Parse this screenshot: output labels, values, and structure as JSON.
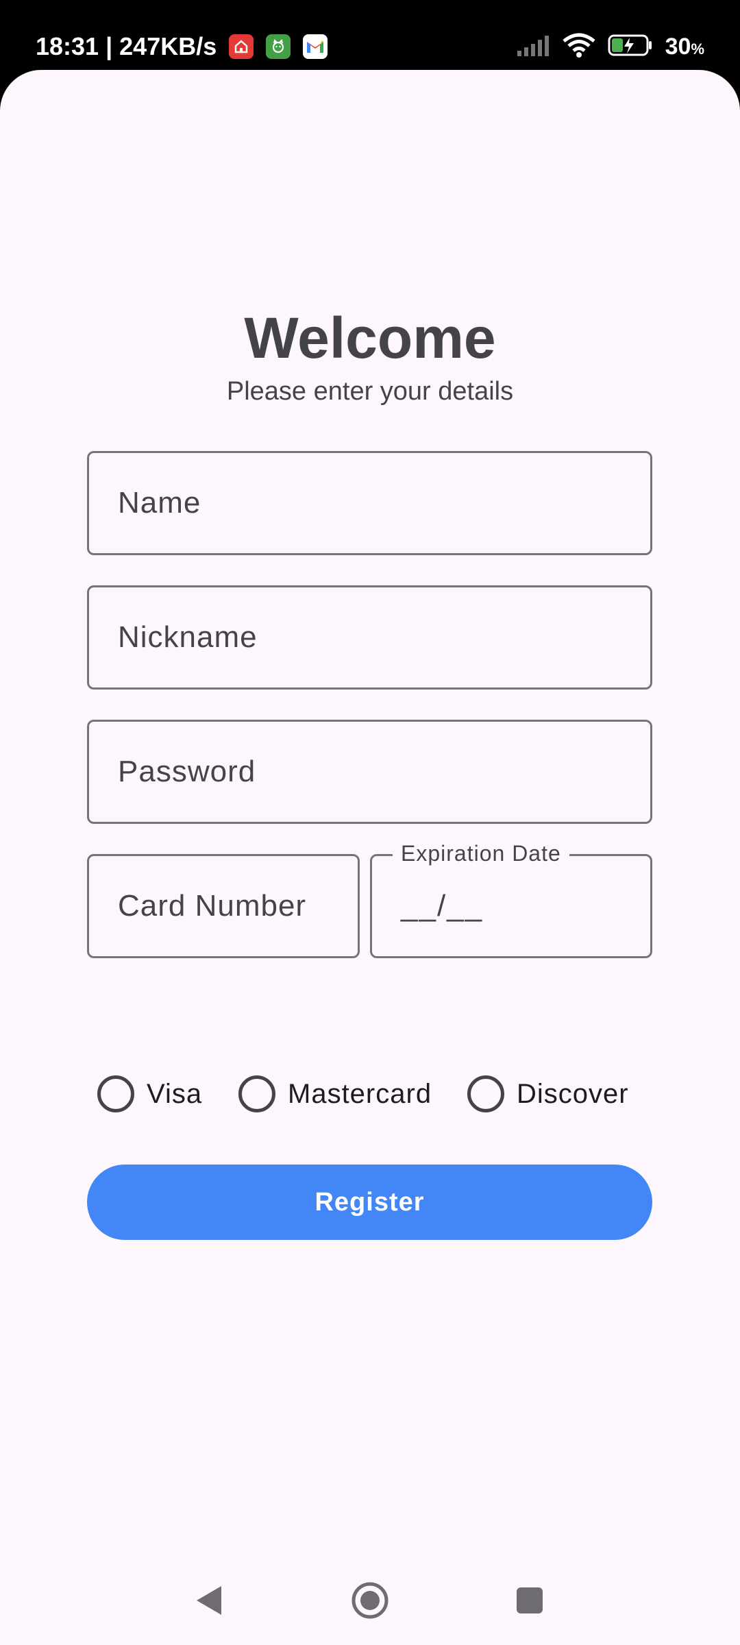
{
  "status_bar": {
    "time": "18:31",
    "separator": "|",
    "speed": "247KB/s",
    "notifications": [
      "home-app-icon",
      "cat-app-icon",
      "gmail-icon"
    ],
    "battery_percent": "30",
    "battery_unit": "%"
  },
  "form": {
    "title": "Welcome",
    "subtitle": "Please enter your details",
    "name_placeholder": "Name",
    "nickname_placeholder": "Nickname",
    "password_placeholder": "Password",
    "card_number_placeholder": "Card Number",
    "expiration_label": "Expiration Date",
    "expiration_placeholder": "__/__",
    "card_types": [
      "Visa",
      "Mastercard",
      "Discover"
    ],
    "register_label": "Register"
  },
  "colors": {
    "background": "#fdf7fd",
    "primary": "#4287f5",
    "text": "#45434a",
    "outline": "#75737a"
  }
}
